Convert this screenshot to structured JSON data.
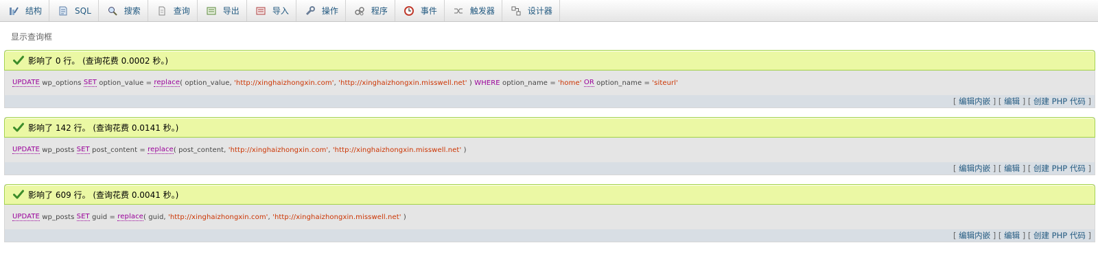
{
  "tabs": [
    {
      "label": "结构",
      "icon": "structure-icon"
    },
    {
      "label": "SQL",
      "icon": "sql-icon"
    },
    {
      "label": "搜索",
      "icon": "search-icon"
    },
    {
      "label": "查询",
      "icon": "query-icon"
    },
    {
      "label": "导出",
      "icon": "export-icon"
    },
    {
      "label": "导入",
      "icon": "import-icon"
    },
    {
      "label": "操作",
      "icon": "wrench-icon"
    },
    {
      "label": "程序",
      "icon": "routines-icon"
    },
    {
      "label": "事件",
      "icon": "clock-icon"
    },
    {
      "label": "触发器",
      "icon": "trigger-icon"
    },
    {
      "label": "设计器",
      "icon": "designer-icon"
    }
  ],
  "query_box_link": "显示查询框",
  "results": [
    {
      "message": "影响了 0 行。 (查询花费 0.0002 秒。)",
      "sql": [
        {
          "t": "UPDATE",
          "c": "kw"
        },
        {
          "t": " wp_options ",
          "c": ""
        },
        {
          "t": "SET",
          "c": "kw"
        },
        {
          "t": " option_value = ",
          "c": ""
        },
        {
          "t": "replace",
          "c": "fn"
        },
        {
          "t": "( option_value, ",
          "c": ""
        },
        {
          "t": "'http://xinghaizhongxin.com'",
          "c": "str"
        },
        {
          "t": ", ",
          "c": ""
        },
        {
          "t": "'http://xinghaizhongxin.misswell.net'",
          "c": "str"
        },
        {
          "t": " ) ",
          "c": ""
        },
        {
          "t": "WHERE",
          "c": "kw2"
        },
        {
          "t": " option_name = ",
          "c": ""
        },
        {
          "t": "'home'",
          "c": "str"
        },
        {
          "t": " ",
          "c": ""
        },
        {
          "t": "OR",
          "c": "kw"
        },
        {
          "t": " option_name = ",
          "c": ""
        },
        {
          "t": "'siteurl'",
          "c": "str"
        }
      ]
    },
    {
      "message": "影响了 142 行。 (查询花费 0.0141 秒。)",
      "sql": [
        {
          "t": "UPDATE",
          "c": "kw"
        },
        {
          "t": " wp_posts ",
          "c": ""
        },
        {
          "t": "SET",
          "c": "kw"
        },
        {
          "t": " post_content = ",
          "c": ""
        },
        {
          "t": "replace",
          "c": "fn"
        },
        {
          "t": "( post_content, ",
          "c": ""
        },
        {
          "t": "'http://xinghaizhongxin.com'",
          "c": "str"
        },
        {
          "t": ", ",
          "c": ""
        },
        {
          "t": "'http://xinghaizhongxin.misswell.net'",
          "c": "str"
        },
        {
          "t": " )",
          "c": ""
        }
      ]
    },
    {
      "message": "影响了 609 行。 (查询花费 0.0041 秒。)",
      "sql": [
        {
          "t": "UPDATE",
          "c": "kw"
        },
        {
          "t": " wp_posts ",
          "c": ""
        },
        {
          "t": "SET",
          "c": "kw"
        },
        {
          "t": " guid = ",
          "c": ""
        },
        {
          "t": "replace",
          "c": "fn"
        },
        {
          "t": "( guid, ",
          "c": ""
        },
        {
          "t": "'http://xinghaizhongxin.com'",
          "c": "str"
        },
        {
          "t": ", ",
          "c": ""
        },
        {
          "t": "'http://xinghaizhongxin.misswell.net'",
          "c": "str"
        },
        {
          "t": " )",
          "c": ""
        }
      ]
    }
  ],
  "tools": {
    "edit_inline": "编辑内嵌",
    "edit": "编辑",
    "create_php": "创建 PHP 代码"
  },
  "colors": {
    "success_bg": "#ebf8a4",
    "success_border": "#a2d246",
    "sql_bg": "#e5e5e5",
    "tools_bg": "#d8dee4",
    "link": "#235a81",
    "keyword": "#990099"
  }
}
